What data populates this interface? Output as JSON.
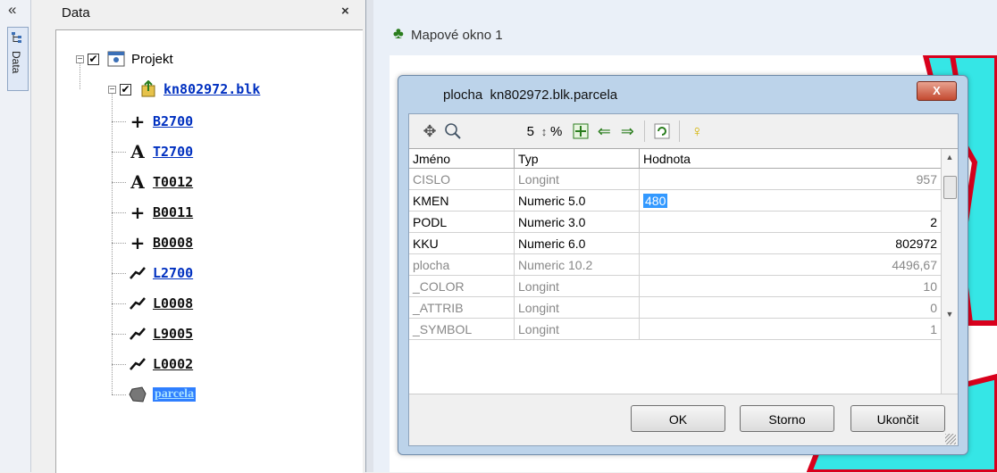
{
  "left_strip": {
    "collapse_glyph": "«",
    "tab_label": "Data"
  },
  "panel": {
    "title": "Data",
    "close_glyph": "×",
    "tree": {
      "root": {
        "label": "Projekt",
        "checked": true,
        "expander": "−"
      },
      "layer": {
        "label": "kn802972.blk",
        "checked": true,
        "expander": "−"
      },
      "children": [
        {
          "icon": "plus-icon",
          "glyph": "+",
          "label": "B2700"
        },
        {
          "icon": "text-icon",
          "glyph": "A",
          "label": "T2700"
        },
        {
          "icon": "text-icon",
          "glyph": "A",
          "label": "T0012"
        },
        {
          "icon": "plus-icon",
          "glyph": "+",
          "label": "B0011"
        },
        {
          "icon": "plus-icon",
          "glyph": "+",
          "label": "B0008"
        },
        {
          "icon": "line-icon",
          "glyph": "",
          "label": "L2700"
        },
        {
          "icon": "line-icon",
          "glyph": "",
          "label": "L0008"
        },
        {
          "icon": "line-icon",
          "glyph": "",
          "label": "L9005"
        },
        {
          "icon": "line-icon",
          "glyph": "",
          "label": "L0002"
        },
        {
          "icon": "polygon-icon",
          "glyph": "",
          "label": "parcela"
        }
      ]
    }
  },
  "map_window": {
    "title": "Mapové okno 1"
  },
  "dialog": {
    "title_prefix": "plocha",
    "title": "kn802972.blk.parcela",
    "close_glyph": "X",
    "toolbar": {
      "zoom_value": "5",
      "spin_glyph": "↕",
      "percent": "%"
    },
    "columns": [
      "Jméno",
      "Typ",
      "Hodnota"
    ],
    "rows": [
      {
        "name": "CISLO",
        "type": "Longint",
        "value": "957",
        "style": "gray"
      },
      {
        "name": "KMEN",
        "type": "Numeric 5.0",
        "value": "480",
        "style": "dark",
        "editing": true
      },
      {
        "name": "PODL",
        "type": "Numeric 3.0",
        "value": "2",
        "style": "dark"
      },
      {
        "name": "KKU",
        "type": "Numeric 6.0",
        "value": "802972",
        "style": "dark"
      },
      {
        "name": "plocha",
        "type": "Numeric 10.2",
        "value": "4496,67",
        "style": "gray"
      },
      {
        "name": "_COLOR",
        "type": "Longint",
        "value": "10",
        "style": "gray"
      },
      {
        "name": "_ATTRIB",
        "type": "Longint",
        "value": "0",
        "style": "gray"
      },
      {
        "name": "_SYMBOL",
        "type": "Longint",
        "value": "1",
        "style": "gray"
      }
    ],
    "buttons": {
      "ok": "OK",
      "cancel": "Storno",
      "close": "Ukončit"
    }
  },
  "colors": {
    "map_cyan": "#35e6e6",
    "map_red": "#d8001c",
    "selection": "#3399ff",
    "link": "#0030c0"
  }
}
